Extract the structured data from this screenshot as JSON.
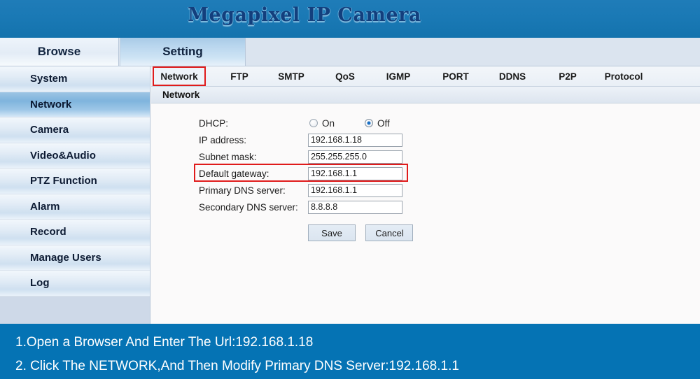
{
  "header": {
    "title": "Megapixel IP Camera"
  },
  "toptabs": [
    {
      "label": "Browse",
      "active": false
    },
    {
      "label": "Setting",
      "active": true
    }
  ],
  "sidebar": {
    "items": [
      {
        "label": "System",
        "selected": false
      },
      {
        "label": "Network",
        "selected": true
      },
      {
        "label": "Camera",
        "selected": false
      },
      {
        "label": "Video&Audio",
        "selected": false
      },
      {
        "label": "PTZ Function",
        "selected": false
      },
      {
        "label": "Alarm",
        "selected": false
      },
      {
        "label": "Record",
        "selected": false
      },
      {
        "label": "Manage Users",
        "selected": false
      },
      {
        "label": "Log",
        "selected": false
      }
    ]
  },
  "main": {
    "tabs": [
      {
        "label": "Network",
        "active": true
      },
      {
        "label": "FTP",
        "active": false
      },
      {
        "label": "SMTP",
        "active": false
      },
      {
        "label": "QoS",
        "active": false
      },
      {
        "label": "IGMP",
        "active": false
      },
      {
        "label": "PORT",
        "active": false
      },
      {
        "label": "DDNS",
        "active": false
      },
      {
        "label": "P2P",
        "active": false
      },
      {
        "label": "Protocol",
        "active": false
      }
    ],
    "section_title": "Network",
    "form": {
      "dhcp": {
        "label": "DHCP:",
        "on_label": "On",
        "off_label": "Off",
        "selected": "Off"
      },
      "fields": [
        {
          "label": "IP address:",
          "value": "192.168.1.18"
        },
        {
          "label": "Subnet mask:",
          "value": "255.255.255.0"
        },
        {
          "label": "Default gateway:",
          "value": "192.168.1.1"
        },
        {
          "label": "Primary DNS server:",
          "value": "192.168.1.1"
        },
        {
          "label": "Secondary DNS server:",
          "value": "8.8.8.8"
        }
      ],
      "save_label": "Save",
      "cancel_label": "Cancel"
    }
  },
  "bottom": {
    "line1": "1.Open a Browser And Enter The Url:192.168.1.18",
    "line2": "2. Click The NETWORK,And Then Modify Primary DNS Server:192.168.1.1"
  },
  "colors": {
    "header_blue": "#1a79b5",
    "banner_blue": "#0573b4",
    "highlight_red": "#e01b1b",
    "sidebar_bg": "#ced9e8",
    "selected_item": "#7fb4dd"
  }
}
